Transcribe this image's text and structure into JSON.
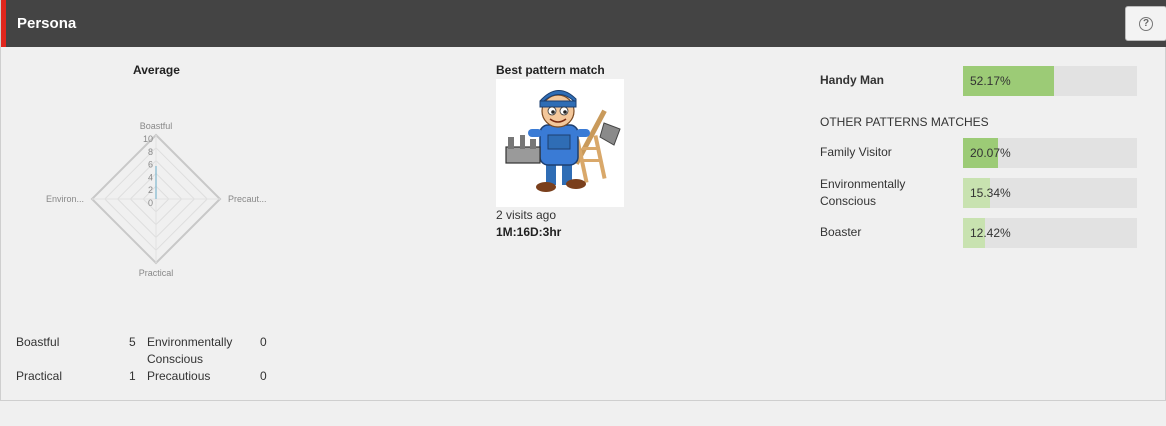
{
  "header": {
    "title": "Persona",
    "help_label": "?"
  },
  "average": {
    "title": "Average",
    "axes": [
      "Boastful",
      "Precaut...",
      "Practical",
      "Environ..."
    ],
    "ticks": [
      "10",
      "8",
      "6",
      "4",
      "2",
      "0"
    ]
  },
  "stats": [
    {
      "label": "Boastful",
      "value": "5",
      "label2": "Environmentally",
      "label2b": "Conscious",
      "value2": "0"
    },
    {
      "label": "Practical",
      "value": "1",
      "label2": "Precautious",
      "value2": "0"
    }
  ],
  "best_match": {
    "title": "Best pattern match",
    "visits": "2 visits ago",
    "duration": "1M:16D:3hr"
  },
  "pattern_matches": {
    "primary": {
      "label": "Handy Man",
      "value_text": "52.17%",
      "value": 0.5217,
      "color": "#9ccb76"
    },
    "other_title": "OTHER PATTERNS MATCHES",
    "others": [
      {
        "label": "Family Visitor",
        "value_text": "20.07%",
        "value": 0.2007,
        "color": "#9ccb76"
      },
      {
        "label": "Environmentally Conscious",
        "value_text": "15.34%",
        "value": 0.1534,
        "color": "#c8e2b0"
      },
      {
        "label": "Boaster",
        "value_text": "12.42%",
        "value": 0.1242,
        "color": "#c8e2b0"
      }
    ]
  }
}
